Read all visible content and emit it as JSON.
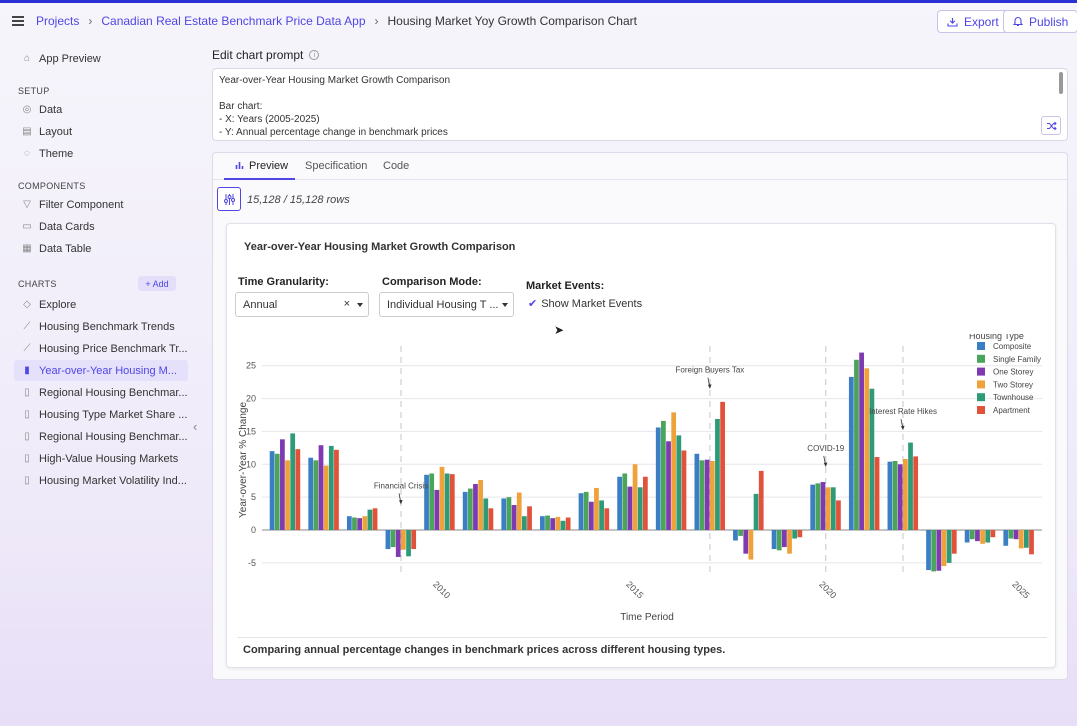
{
  "colors": {
    "accent": "#4f46e5",
    "topbar_stripe": "#2c2ed6"
  },
  "breadcrumb": {
    "projects": "Projects",
    "app": "Canadian Real Estate Benchmark Price Data App",
    "current": "Housing Market Yoy Growth Comparison Chart"
  },
  "header": {
    "export_label": "Export",
    "publish_label": "Publish",
    "export_icon": "download-tray-icon",
    "publish_icon": "bell-icon"
  },
  "sidebar": {
    "app_preview": "App Preview",
    "setup_heading": "SETUP",
    "setup_items": [
      "Data",
      "Layout",
      "Theme"
    ],
    "components_heading": "COMPONENTS",
    "components_items": [
      "Filter Component",
      "Data Cards",
      "Data Table"
    ],
    "charts_heading": "CHARTS",
    "add_label": "+ Add",
    "charts_items": [
      "Explore",
      "Housing Benchmark Trends",
      "Housing Price Benchmark Tr...",
      "Year-over-Year Housing M...",
      "Regional Housing Benchmar...",
      "Housing Type Market Share ...",
      "Regional Housing Benchmar...",
      "High-Value Housing Markets",
      "Housing Market Volatility Ind..."
    ],
    "active_chart_index": 3
  },
  "prompt": {
    "label": "Edit chart prompt",
    "lines": [
      "Year-over-Year Housing Market Growth Comparison",
      "",
      "Bar chart:",
      "- X: Years (2005-2025)",
      "- Y: Annual percentage change in benchmark prices"
    ]
  },
  "tabs": {
    "preview": "Preview",
    "specification": "Specification",
    "code": "Code"
  },
  "rows_text": "15,128 / 15,128 rows",
  "card": {
    "title": "Year-over-Year Housing Market Growth Comparison",
    "granularity_label": "Time Granularity:",
    "granularity_value": "Annual",
    "clear_symbol": "×",
    "comparison_label": "Comparison Mode:",
    "comparison_value": "Individual Housing T ...",
    "events_label": "Market Events:",
    "events_check": "Show Market Events",
    "footer": "Comparing annual percentage changes in benchmark prices across different housing types."
  },
  "chart_data": {
    "type": "bar",
    "xlabel": "Time Period",
    "ylabel": "Year-over-Year % Change",
    "ylim": [
      -7,
      28
    ],
    "yticks": [
      -5,
      0,
      5,
      10,
      15,
      20,
      25
    ],
    "xlim": [
      2005.4,
      2025.6
    ],
    "xticks": [
      2010,
      2015,
      2020,
      2025
    ],
    "grid": true,
    "legend_title": "Housing Type",
    "legend_position": "top-right",
    "x": [
      2006,
      2007,
      2008,
      2009,
      2010,
      2011,
      2012,
      2013,
      2014,
      2015,
      2016,
      2017,
      2018,
      2019,
      2020,
      2021,
      2022,
      2023,
      2024,
      2025
    ],
    "series": [
      {
        "name": "Composite",
        "color": "#3b7ec4",
        "values": [
          12.0,
          11.0,
          2.1,
          -2.9,
          8.4,
          5.8,
          4.8,
          2.1,
          5.6,
          8.1,
          15.6,
          11.6,
          -1.6,
          -2.9,
          6.9,
          23.3,
          10.4,
          -6.1,
          -1.9,
          -2.4
        ]
      },
      {
        "name": "Single Family",
        "color": "#4aa45a",
        "values": [
          11.6,
          10.6,
          1.9,
          -2.6,
          8.6,
          6.3,
          5.0,
          2.2,
          5.8,
          8.6,
          16.6,
          10.6,
          -0.9,
          -3.1,
          7.1,
          25.9,
          10.5,
          -6.3,
          -1.4,
          -1.3
        ]
      },
      {
        "name": "One Storey",
        "color": "#7f3ab2",
        "values": [
          13.8,
          12.9,
          1.8,
          -4.1,
          6.1,
          7.0,
          3.8,
          1.8,
          4.3,
          6.6,
          13.5,
          10.7,
          -3.6,
          -2.6,
          7.3,
          27.0,
          10.0,
          -6.2,
          -1.7,
          -1.4
        ]
      },
      {
        "name": "Two Storey",
        "color": "#efa13a",
        "values": [
          10.6,
          9.8,
          2.1,
          -3.0,
          9.6,
          7.6,
          5.7,
          2.0,
          6.4,
          10.0,
          17.9,
          10.5,
          -4.5,
          -3.6,
          6.5,
          24.6,
          10.8,
          -5.5,
          -2.1,
          -2.8
        ]
      },
      {
        "name": "Townhouse",
        "color": "#2e9a78",
        "values": [
          14.7,
          12.8,
          3.1,
          -4.0,
          8.6,
          4.8,
          2.1,
          1.4,
          4.5,
          6.5,
          14.4,
          16.9,
          5.5,
          -1.3,
          6.5,
          21.5,
          13.3,
          -5.0,
          -1.9,
          -2.7
        ]
      },
      {
        "name": "Apartment",
        "color": "#e0523a",
        "values": [
          12.3,
          12.2,
          3.3,
          -2.9,
          8.5,
          3.3,
          3.6,
          1.9,
          3.3,
          8.1,
          12.1,
          19.5,
          9.0,
          -1.1,
          4.5,
          11.1,
          11.2,
          -3.6,
          -1.1,
          -3.7
        ]
      }
    ],
    "annotations": [
      {
        "text": "Financial Crisis",
        "x": 2009,
        "y": 3.9
      },
      {
        "text": "Foreign Buyers Tax",
        "x": 2017,
        "y": 21.5
      },
      {
        "text": "COVID-19",
        "x": 2020,
        "y": 9.6
      },
      {
        "text": "Interest Rate Hikes",
        "x": 2022,
        "y": 15.2
      }
    ],
    "event_lines_x": [
      2009,
      2017,
      2020,
      2022
    ]
  }
}
